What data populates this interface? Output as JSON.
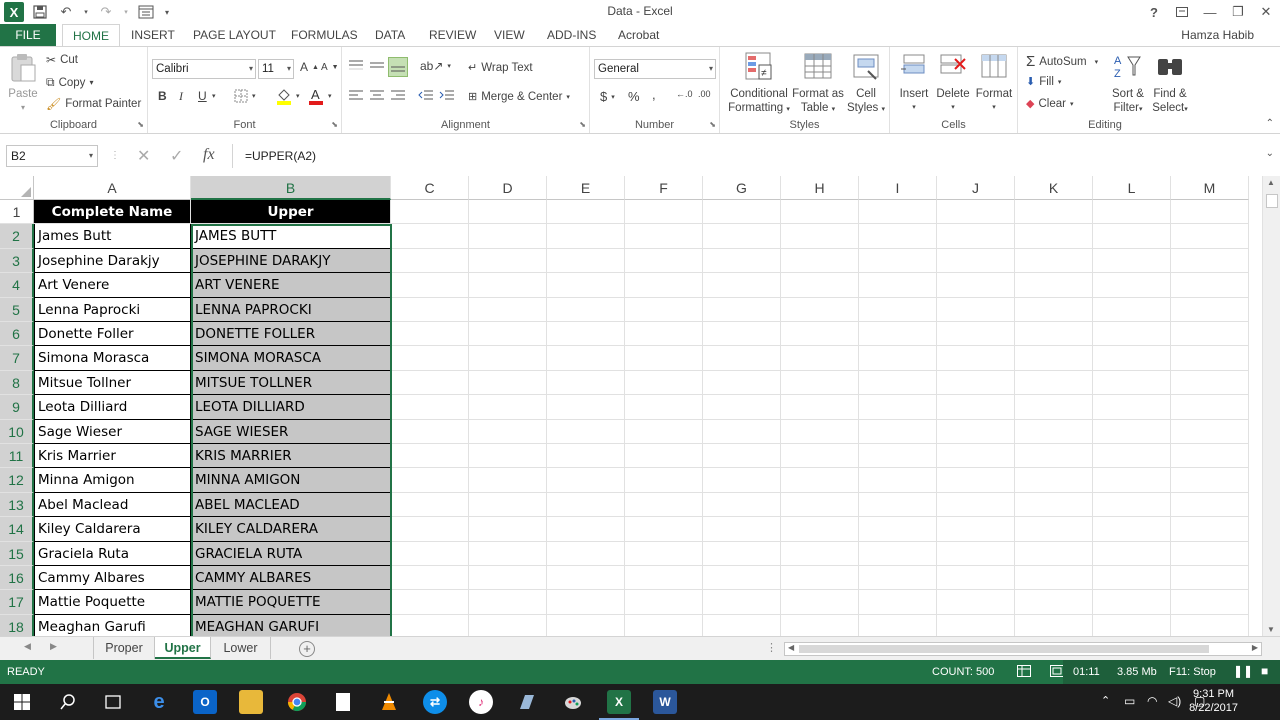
{
  "window": {
    "title": "Data - Excel",
    "help": "?",
    "user_name": "Hamza Habib"
  },
  "ribbon_tabs": [
    "FILE",
    "HOME",
    "INSERT",
    "PAGE LAYOUT",
    "FORMULAS",
    "DATA",
    "REVIEW",
    "VIEW",
    "ADD-INS",
    "Acrobat"
  ],
  "active_tab": "HOME",
  "clipboard": {
    "paste": "Paste",
    "cut": "Cut",
    "copy": "Copy",
    "format_painter": "Format Painter",
    "label": "Clipboard"
  },
  "font": {
    "name": "Calibri",
    "size": "11",
    "bold": "B",
    "italic": "I",
    "underline": "U",
    "label": "Font"
  },
  "alignment": {
    "wrap_text": "Wrap Text",
    "merge_center": "Merge & Center",
    "label": "Alignment"
  },
  "number": {
    "format": "General",
    "currency": "$",
    "percent": "%",
    "comma": ",",
    "label": "Number"
  },
  "styles": {
    "conditional_1": "Conditional",
    "conditional_2": "Formatting",
    "format_table_1": "Format as",
    "format_table_2": "Table",
    "cell_styles_1": "Cell",
    "cell_styles_2": "Styles",
    "label": "Styles"
  },
  "cells": {
    "insert": "Insert",
    "delete": "Delete",
    "format": "Format",
    "label": "Cells"
  },
  "editing": {
    "autosum": "AutoSum",
    "fill": "Fill",
    "clear": "Clear",
    "sort_1": "Sort &",
    "sort_2": "Filter",
    "find_1": "Find &",
    "find_2": "Select",
    "label": "Editing"
  },
  "formula_bar": {
    "name_box": "B2",
    "fx": "fx",
    "formula": "=UPPER(A2)"
  },
  "columns": [
    "A",
    "B",
    "C",
    "D",
    "E",
    "F",
    "G",
    "H",
    "I",
    "J",
    "K",
    "L",
    "M"
  ],
  "rows": [
    "1",
    "2",
    "3",
    "4",
    "5",
    "6",
    "7",
    "8",
    "9",
    "10",
    "11",
    "12",
    "13",
    "14",
    "15",
    "16",
    "17",
    "18"
  ],
  "headers": {
    "a": "Complete Name",
    "b": "Upper"
  },
  "data": [
    {
      "name": "James Butt",
      "upper": "JAMES BUTT"
    },
    {
      "name": "Josephine Darakjy",
      "upper": "JOSEPHINE DARAKJY"
    },
    {
      "name": "Art Venere",
      "upper": "ART VENERE"
    },
    {
      "name": "Lenna Paprocki",
      "upper": "LENNA PAPROCKI"
    },
    {
      "name": "Donette Foller",
      "upper": "DONETTE FOLLER"
    },
    {
      "name": "Simona Morasca",
      "upper": "SIMONA MORASCA"
    },
    {
      "name": "Mitsue Tollner",
      "upper": "MITSUE TOLLNER"
    },
    {
      "name": "Leota Dilliard",
      "upper": "LEOTA DILLIARD"
    },
    {
      "name": "Sage Wieser",
      "upper": "SAGE WIESER"
    },
    {
      "name": "Kris Marrier",
      "upper": "KRIS MARRIER"
    },
    {
      "name": "Minna Amigon",
      "upper": "MINNA AMIGON"
    },
    {
      "name": "Abel Maclead",
      "upper": "ABEL MACLEAD"
    },
    {
      "name": "Kiley Caldarera",
      "upper": "KILEY CALDARERA"
    },
    {
      "name": "Graciela Ruta",
      "upper": "GRACIELA RUTA"
    },
    {
      "name": "Cammy Albares",
      "upper": "CAMMY ALBARES"
    },
    {
      "name": "Mattie Poquette",
      "upper": "MATTIE POQUETTE"
    },
    {
      "name": "Meaghan Garufi",
      "upper": "MEAGHAN GARUFI"
    }
  ],
  "sheets": [
    "Proper",
    "Upper",
    "Lower"
  ],
  "active_sheet": "Upper",
  "status": {
    "ready": "READY",
    "count": "COUNT: 500",
    "rec_time": "01:11",
    "rec_size": "3.85 Mb",
    "rec_stop": "F11: Stop"
  },
  "taskbar": {
    "time": "9:31 PM",
    "date": "8/22/2017"
  },
  "colors": {
    "excel_green": "#217346",
    "selection_gray": "#c6c6c6",
    "header_black": "#000000"
  }
}
